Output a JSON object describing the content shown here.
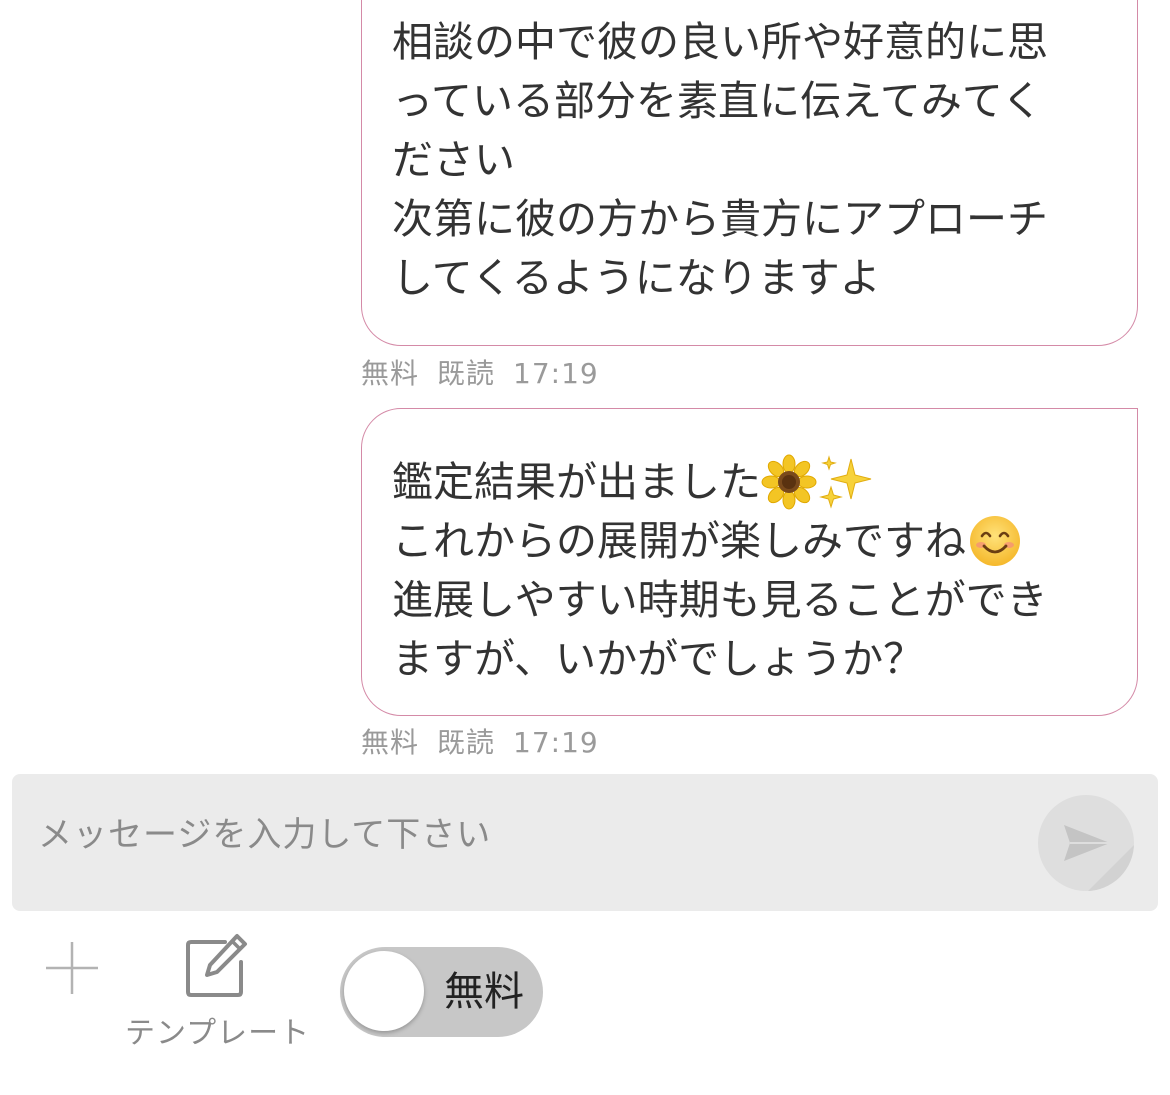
{
  "messages": [
    {
      "lines": [
        "相談の中で彼の良い所や好意的に思",
        "っている部分を素直に伝えてみてく",
        "ださい",
        "次第に彼の方から貴方にアプローチ",
        "してくるようになりますよ"
      ],
      "price": "無料",
      "read": "既読",
      "time": "17:19"
    },
    {
      "line1": "鑑定結果が出ました",
      "line1_emojis": [
        "sunflower-emoji",
        "sparkles-emoji"
      ],
      "line2": "これからの展開が楽しみですね",
      "line2_emoji": "smiling-face-emoji",
      "line3": "進展しやすい時期も見ることができ",
      "line4": "ますが、いかがでしょうか？",
      "price": "無料",
      "read": "既読",
      "time": "17:19"
    }
  ],
  "composer": {
    "placeholder": "メッセージを入力して下さい",
    "value": "",
    "send_icon": "send-arrow-icon",
    "plus_icon": "plus-icon",
    "template_icon": "edit-icon",
    "template_label": "テンプレート",
    "toggle_label": "無料",
    "toggle_on": false
  },
  "colors": {
    "bubble_border": "#d48aa7",
    "meta_text": "#9a9a9a",
    "input_bg": "#ebebeb",
    "toggle_bg": "#c7c7c7"
  }
}
